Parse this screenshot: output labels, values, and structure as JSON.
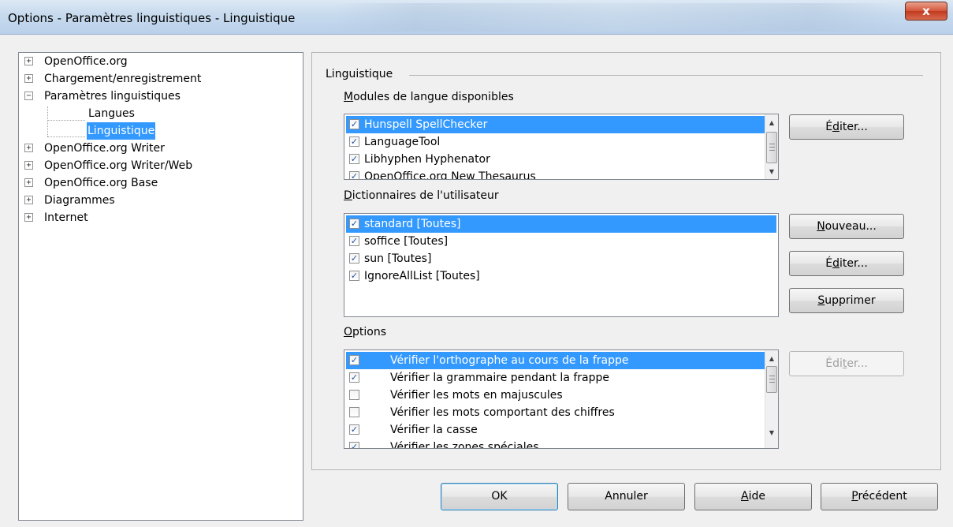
{
  "window": {
    "title": "Options - Paramètres linguistiques - Linguistique",
    "close_label": "x"
  },
  "tree": {
    "items": [
      {
        "label": "OpenOffice.org",
        "expander": "+"
      },
      {
        "label": "Chargement/enregistrement",
        "expander": "+"
      },
      {
        "label": "Paramètres linguistiques",
        "expander": "−"
      },
      {
        "label": "Langues",
        "expander": ""
      },
      {
        "label": "Linguistique",
        "expander": "",
        "selected": true
      },
      {
        "label": "OpenOffice.org Writer",
        "expander": "+"
      },
      {
        "label": "OpenOffice.org Writer/Web",
        "expander": "+"
      },
      {
        "label": "OpenOffice.org Base",
        "expander": "+"
      },
      {
        "label": "Diagrammes",
        "expander": "+"
      },
      {
        "label": "Internet",
        "expander": "+"
      }
    ]
  },
  "panel": {
    "title": "Linguistique",
    "modules": {
      "label_u": "M",
      "label_rest": "odules de langue disponibles",
      "items": [
        {
          "label": "Hunspell SpellChecker",
          "checked": true,
          "selected": true
        },
        {
          "label": "LanguageTool",
          "checked": true
        },
        {
          "label": "Libhyphen Hyphenator",
          "checked": true
        },
        {
          "label": "OpenOffice.org New Thesaurus",
          "checked": true
        }
      ],
      "edit_pre": "É",
      "edit_u": "d",
      "edit_post": "iter..."
    },
    "dictionaries": {
      "label_u": "D",
      "label_rest": "ictionnaires de l'utilisateur",
      "items": [
        {
          "label": "standard [Toutes]",
          "checked": true,
          "selected": true
        },
        {
          "label": "soffice [Toutes]",
          "checked": true
        },
        {
          "label": "sun [Toutes]",
          "checked": true
        },
        {
          "label": "IgnoreAllList [Toutes]",
          "checked": true
        }
      ],
      "new_u": "N",
      "new_rest": "ouveau...",
      "edit_pre": "É",
      "edit_u": "d",
      "edit_post": "iter...",
      "delete_u": "S",
      "delete_rest": "upprimer"
    },
    "options": {
      "label_u": "O",
      "label_rest": "ptions",
      "items": [
        {
          "label": "Vérifier l'orthographe au cours de la frappe",
          "checked": true,
          "selected": true
        },
        {
          "label": "Vérifier la grammaire pendant la frappe",
          "checked": true
        },
        {
          "label": "Vérifier les mots en majuscules",
          "checked": false
        },
        {
          "label": "Vérifier les mots comportant des chiffres",
          "checked": false
        },
        {
          "label": "Vérifier la casse",
          "checked": true
        },
        {
          "label": "Vérifier les zones spéciales",
          "checked": true
        }
      ],
      "edit_pre": "Édi",
      "edit_u": "t",
      "edit_post": "er..."
    }
  },
  "buttons": {
    "ok": "OK",
    "cancel": "Annuler",
    "help_u": "A",
    "help_rest": "ide",
    "back_u": "P",
    "back_rest": "récédent"
  }
}
